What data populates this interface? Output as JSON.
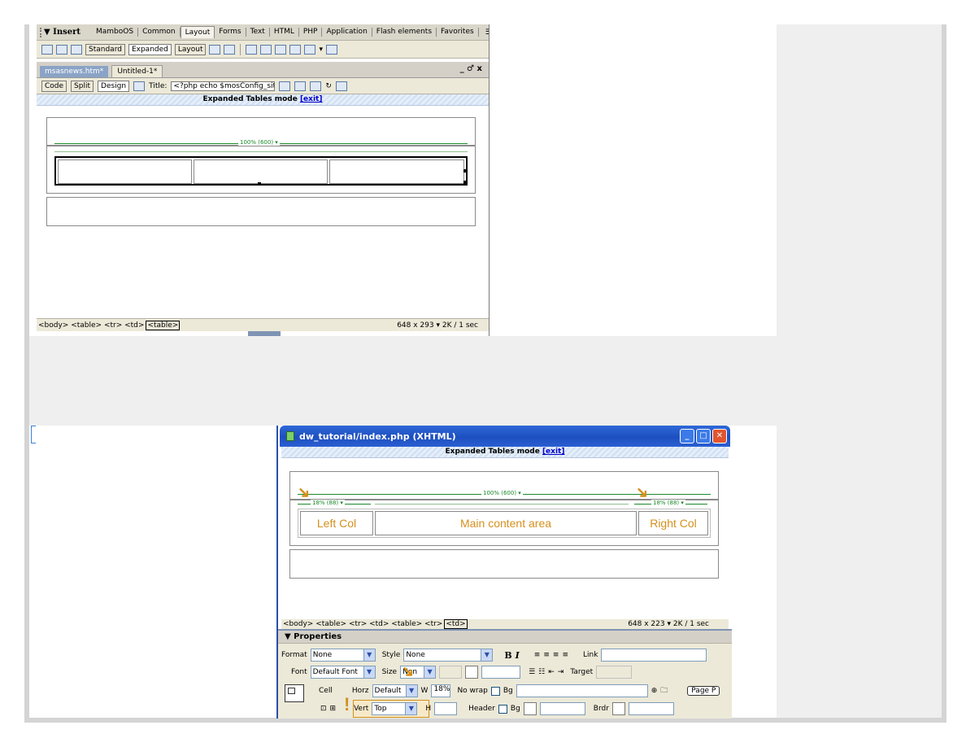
{
  "shot1": {
    "insert_bar": {
      "title": "▼ Insert",
      "tabs": [
        "MamboOS",
        "Common",
        "Layout",
        "Forms",
        "Text",
        "HTML",
        "PHP",
        "Application",
        "Flash elements",
        "Favorites"
      ],
      "active_tab": "Layout"
    },
    "layout_toolbar": {
      "standard": "Standard",
      "expanded": "Expanded",
      "layout": "Layout"
    },
    "doc_tabs": [
      "msasnews.htm*",
      "Untitled-1*"
    ],
    "window_controls": "_ ♂ x",
    "doc_toolbar": {
      "code": "Code",
      "split": "Split",
      "design": "Design",
      "title_label": "Title:",
      "title_value": "<?php echo $mosConfig_siten"
    },
    "banner": {
      "text": "Expanded Tables mode ",
      "exit": "[exit]"
    },
    "width_label": "100% (600) ▾",
    "status": {
      "tags": "<body> <table> <tr> <td>",
      "selected_tag": "<table>",
      "size": "648 x 293 ▾ 2K / 1 sec"
    }
  },
  "shot2": {
    "window_title": "dw_tutorial/index.php (XHTML)",
    "banner": {
      "text": "Expanded Tables mode ",
      "exit": "[exit]"
    },
    "width_labels": {
      "total": "100% (600) ▾",
      "left": "18% (88) ▾",
      "right": "18% (88) ▾"
    },
    "cells": {
      "left": "Left Col",
      "main": "Main content area",
      "right": "Right Col"
    },
    "status": {
      "tags": "<body> <table> <tr> <td> <table> <tr>",
      "selected_tag": "<td>",
      "size": "648 x 223 ▾ 2K / 1 sec"
    },
    "properties": {
      "header": "▼ Properties",
      "format_label": "Format",
      "format_value": "None",
      "style_label": "Style",
      "style_value": "None",
      "bold": "B",
      "italic": "I",
      "link_label": "Link",
      "font_label": "Font",
      "font_value": "Default Font",
      "size_label": "Size",
      "size_value": "Non",
      "target_label": "Target",
      "cell_label": "Cell",
      "horz_label": "Horz",
      "horz_value": "Default",
      "w_label": "W",
      "w_value": "18%",
      "nowrap_label": "No wrap",
      "bg_label": "Bg",
      "vert_label": "Vert",
      "vert_value": "Top",
      "h_label": "H",
      "header_label": "Header",
      "brdr_label": "Brdr",
      "page_btn": "Page P"
    }
  },
  "colors": {
    "accent_annotation": "#d4901d",
    "width_guide": "#1b8a2a",
    "xp_title": "#1e4fc0"
  }
}
